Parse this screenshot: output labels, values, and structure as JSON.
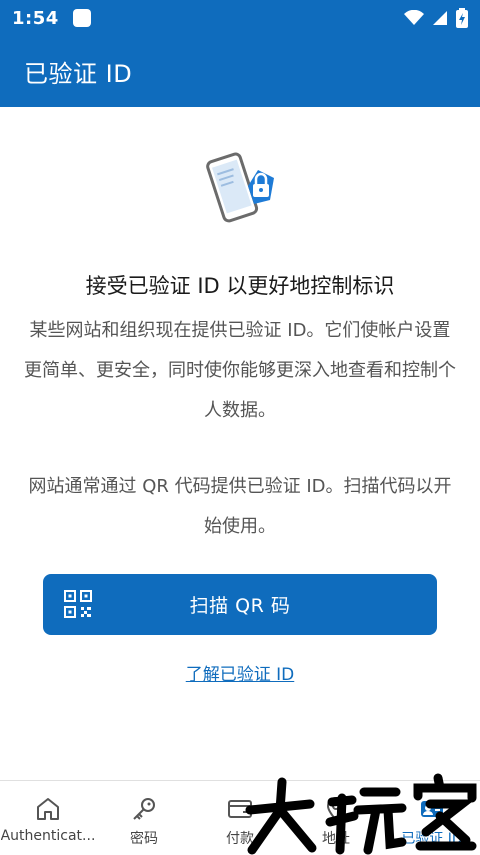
{
  "status": {
    "time": "1:54"
  },
  "app_bar": {
    "title": "已验证 ID"
  },
  "main": {
    "heading": "接受已验证 ID 以更好地控制标识",
    "paragraph_1": "某些网站和组织现在提供已验证 ID。它们使帐户设置更简单、更安全，同时使你能够更深入地查看和控制个人数据。",
    "paragraph_2": "网站通常通过 QR 代码提供已验证 ID。扫描代码以开始使用。",
    "scan_button_label": "扫描 QR 码",
    "learn_link": "了解已验证 ID"
  },
  "bottom_nav": {
    "items": [
      {
        "label": "Authenticat...",
        "icon": "home-icon"
      },
      {
        "label": "密码",
        "icon": "key-icon"
      },
      {
        "label": "付款",
        "icon": "card-icon"
      },
      {
        "label": "地址",
        "icon": "location-icon"
      },
      {
        "label": "已验证 ID",
        "icon": "verified-id-icon"
      }
    ]
  },
  "colors": {
    "accent": "#0f6cbd"
  }
}
